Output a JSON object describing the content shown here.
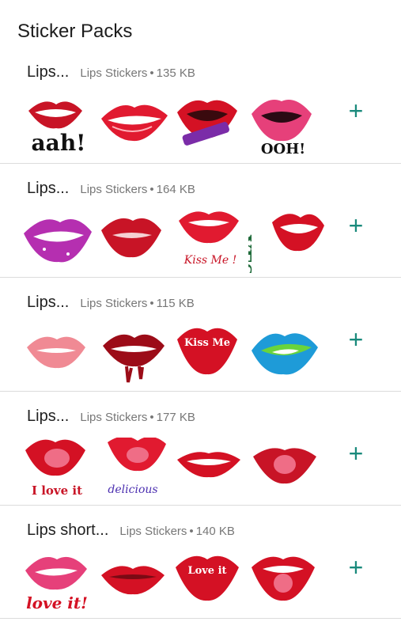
{
  "header": {
    "title": "Sticker Packs"
  },
  "packs": [
    {
      "name": "Lips...",
      "publisher": "Lips Stickers",
      "size": "135 KB",
      "sticker_captions": [
        "aah!",
        "",
        "",
        "OOH!"
      ]
    },
    {
      "name": "Lips...",
      "publisher": "Lips Stickers",
      "size": "164 KB",
      "sticker_captions": [
        "",
        "",
        "Kiss Me !",
        "YES"
      ]
    },
    {
      "name": "Lips...",
      "publisher": "Lips Stickers",
      "size": "115 KB",
      "sticker_captions": [
        "",
        "",
        "Kiss Me",
        ""
      ]
    },
    {
      "name": "Lips...",
      "publisher": "Lips Stickers",
      "size": "177 KB",
      "sticker_captions": [
        "I love it",
        "delicious",
        "",
        ""
      ]
    },
    {
      "name": "Lips short...",
      "publisher": "Lips Stickers",
      "size": "140 KB",
      "sticker_captions": [
        "love it!",
        "",
        "Love it",
        ""
      ]
    }
  ],
  "colors": {
    "accent": "#1a8a7c",
    "lip_red": "#d3142a",
    "lip_pink": "#e6407a",
    "divider": "#dcdcdc"
  },
  "icons": {
    "add": "plus-icon"
  }
}
